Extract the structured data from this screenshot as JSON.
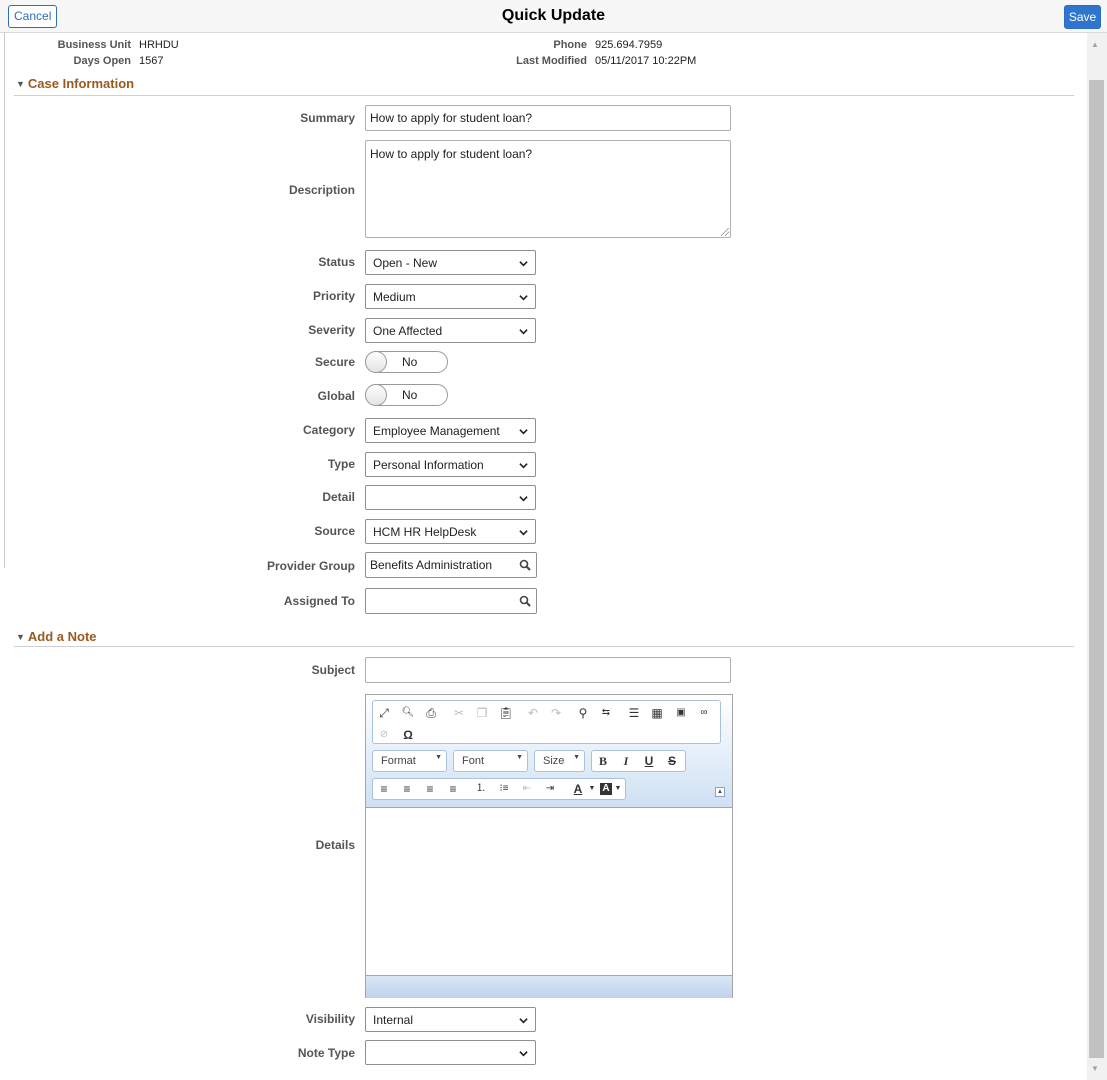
{
  "header": {
    "title": "Quick Update",
    "cancel_label": "Cancel",
    "save_label": "Save"
  },
  "case_info": {
    "business_unit_label": "Business Unit",
    "business_unit": "HRHDU",
    "days_open_label": "Days Open",
    "days_open": "1567",
    "phone_label": "Phone",
    "phone": "925.694.7959",
    "last_modified_label": "Last Modified",
    "last_modified": "05/11/2017 10:22PM"
  },
  "case_section": {
    "title": "Case Information",
    "summary_label": "Summary",
    "summary": "How to apply for student loan?",
    "description_label": "Description",
    "description": "How to apply for student loan?",
    "status_label": "Status",
    "status": "Open - New",
    "priority_label": "Priority",
    "priority": "Medium",
    "severity_label": "Severity",
    "severity": "One Affected",
    "secure_label": "Secure",
    "secure": "No",
    "global_label": "Global",
    "global": "No",
    "category_label": "Category",
    "category": "Employee Management",
    "type_label": "Type",
    "type": "Personal Information",
    "detail_label": "Detail",
    "detail": "",
    "source_label": "Source",
    "source": "HCM HR HelpDesk",
    "provider_group_label": "Provider Group",
    "provider_group": "Benefits Administration",
    "assigned_to_label": "Assigned To",
    "assigned_to": ""
  },
  "note_section": {
    "title": "Add a Note",
    "subject_label": "Subject",
    "subject": "",
    "details_label": "Details",
    "editor": {
      "format_label": "Format",
      "font_label": "Font",
      "size_label": "Size"
    },
    "visibility_label": "Visibility",
    "visibility": "Internal",
    "note_type_label": "Note Type",
    "note_type": ""
  }
}
